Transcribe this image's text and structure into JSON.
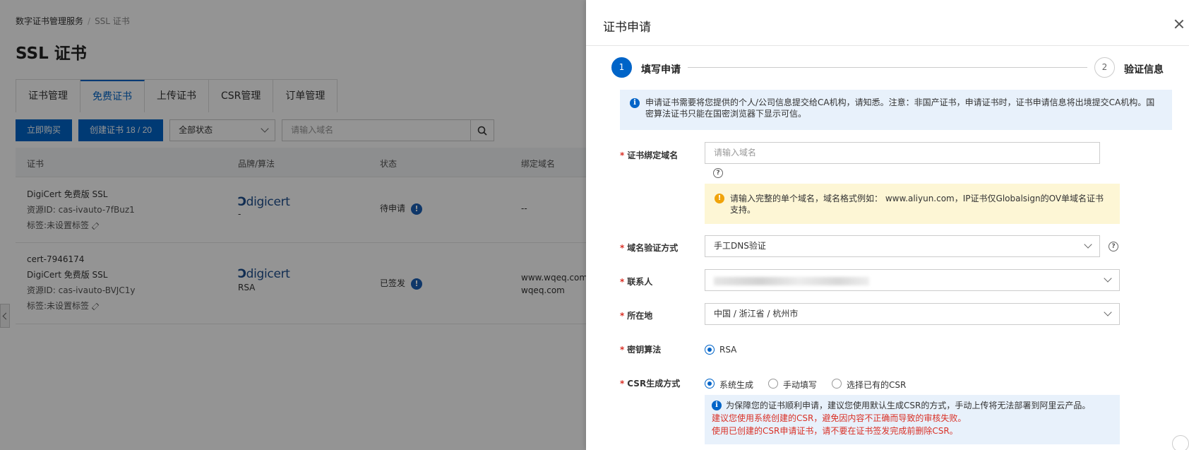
{
  "breadcrumb": {
    "parent": "数字证书管理服务",
    "separator": "/",
    "current": "SSL 证书"
  },
  "page": {
    "title": "SSL 证书"
  },
  "tabs": [
    {
      "label": "证书管理",
      "active": false
    },
    {
      "label": "免费证书",
      "active": true
    },
    {
      "label": "上传证书",
      "active": false
    },
    {
      "label": "CSR管理",
      "active": false
    },
    {
      "label": "订单管理",
      "active": false
    }
  ],
  "toolbar": {
    "buy_label": "立即购买",
    "create_label": "创建证书 18 / 20",
    "status_filter": "全部状态",
    "search_placeholder": "请输入域名"
  },
  "table": {
    "headers": {
      "cert": "证书",
      "brand": "品牌/算法",
      "status": "状态",
      "domain": "绑定域名"
    },
    "rows": [
      {
        "lines": [
          "DigiCert 免费版 SSL",
          "资源ID: cas-ivauto-7fBuz1",
          "标签:未设置标签"
        ],
        "brand": "digicert",
        "algo": "-",
        "status": "待申请",
        "domains": [
          "--"
        ]
      },
      {
        "lines": [
          "cert-7946174",
          "DigiCert 免费版 SSL",
          "资源ID: cas-ivauto-BVJC1y",
          "标签:未设置标签"
        ],
        "brand": "digicert",
        "algo": "RSA",
        "status": "已签发",
        "domains": [
          "www.wqeq.com",
          "wqeq.com"
        ]
      }
    ]
  },
  "drawer": {
    "title": "证书申请",
    "steps": [
      {
        "number": "1",
        "label": "填写申请"
      },
      {
        "number": "2",
        "label": "验证信息"
      }
    ],
    "notice": "申请证书需要将您提供的个人/公司信息提交给CA机构，请知悉。注意：非国产证书，申请证书时，证书申请信息将出境提交CA机构。国密算法证书只能在国密浏览器下显示可信。",
    "fields": {
      "domain": {
        "label": "证书绑定域名",
        "placeholder": "请输入域名"
      },
      "domain_hint": "请输入完整的单个域名，域名格式例如： www.aliyun.com，IP证书仅Globalsign的OV单域名证书支持。",
      "verify": {
        "label": "域名验证方式",
        "value": "手工DNS验证"
      },
      "contact": {
        "label": "联系人"
      },
      "location": {
        "label": "所在地",
        "value": "中国 / 浙江省 / 杭州市"
      },
      "algo": {
        "label": "密钥算法",
        "option": "RSA"
      },
      "csr": {
        "label": "CSR生成方式",
        "options": [
          "系统生成",
          "手动填写",
          "选择已有的CSR"
        ],
        "selected": "系统生成",
        "info": "为保障您的证书顺利申请，建议您使用默认生成CSR的方式，手动上传将无法部署到阿里云产品。",
        "warn1": "建议您使用系统创建的CSR，避免因内容不正确而导致的审核失败。",
        "warn2": "使用已创建的CSR申请证书，请不要在证书签发完成前删除CSR。"
      }
    }
  },
  "colors": {
    "primary": "#0064c8",
    "required": "#d93026",
    "warning": "#f0a30a"
  }
}
